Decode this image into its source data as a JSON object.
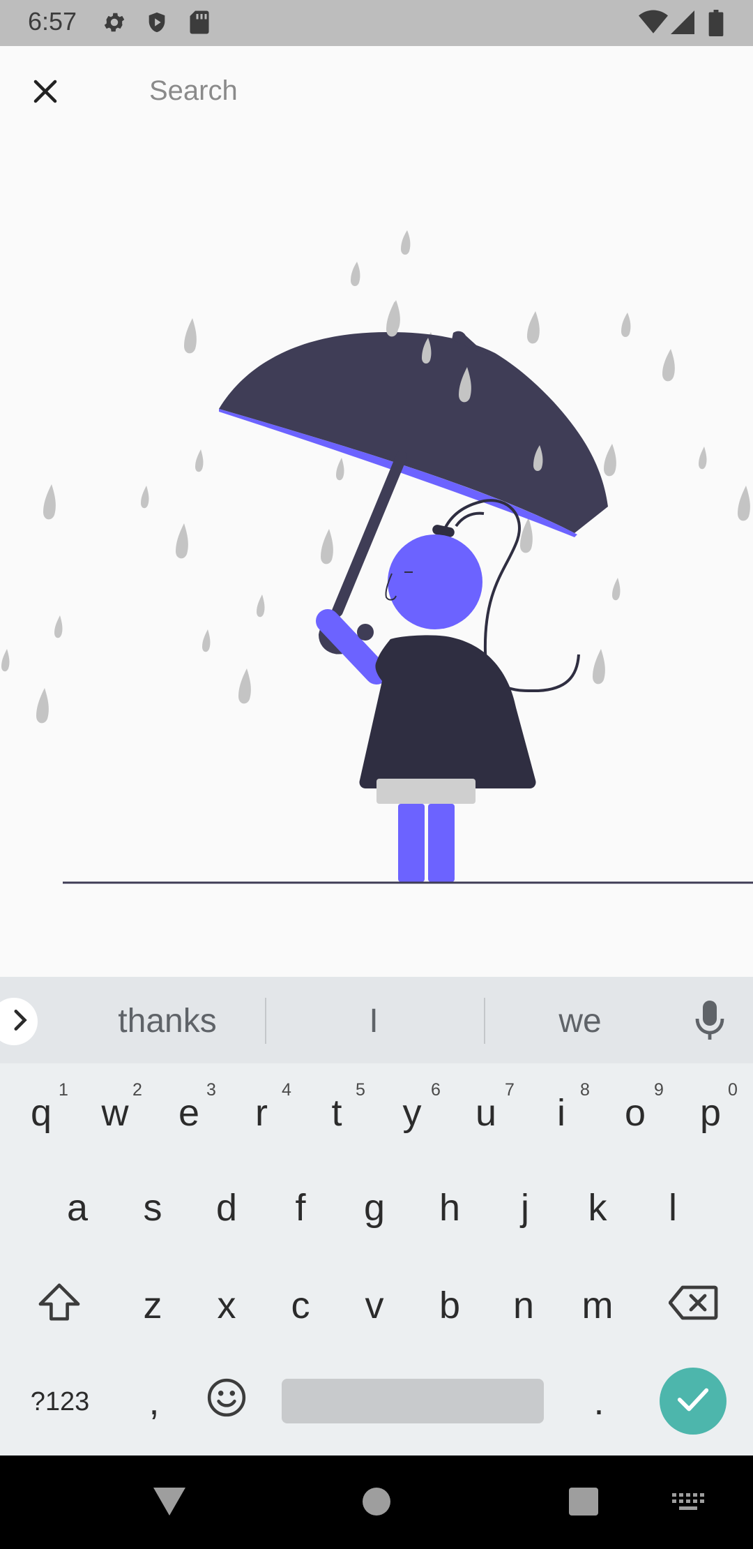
{
  "status_bar": {
    "time": "6:57",
    "left_icons": [
      "settings-icon",
      "shield-icon",
      "sd-card-icon"
    ],
    "right_icons": [
      "wifi-icon",
      "cell-signal-icon",
      "battery-icon"
    ]
  },
  "search": {
    "placeholder": "Search",
    "value": "",
    "close_icon": "close-icon"
  },
  "illustration": {
    "description_icon": "girl-with-umbrella-in-rain-illustration",
    "colors": {
      "umbrella": "#3f3d56",
      "accent": "#6c63ff",
      "rain": "#c4c4c4",
      "ground": "#3f3d56"
    }
  },
  "keyboard": {
    "suggestions": [
      "thanks",
      "I",
      "we"
    ],
    "row1": [
      {
        "key": "q",
        "num": "1"
      },
      {
        "key": "w",
        "num": "2"
      },
      {
        "key": "e",
        "num": "3"
      },
      {
        "key": "r",
        "num": "4"
      },
      {
        "key": "t",
        "num": "5"
      },
      {
        "key": "y",
        "num": "6"
      },
      {
        "key": "u",
        "num": "7"
      },
      {
        "key": "i",
        "num": "8"
      },
      {
        "key": "o",
        "num": "9"
      },
      {
        "key": "p",
        "num": "0"
      }
    ],
    "row2": [
      "a",
      "s",
      "d",
      "f",
      "g",
      "h",
      "j",
      "k",
      "l"
    ],
    "row3": [
      "z",
      "x",
      "c",
      "v",
      "b",
      "n",
      "m"
    ],
    "symbols_label": "?123",
    "comma_label": ",",
    "period_label": ".",
    "accent_color": "#4db6ac"
  },
  "nav_bar": {
    "icons": [
      "back-icon",
      "home-icon",
      "recents-icon",
      "keyboard-switch-icon"
    ]
  }
}
